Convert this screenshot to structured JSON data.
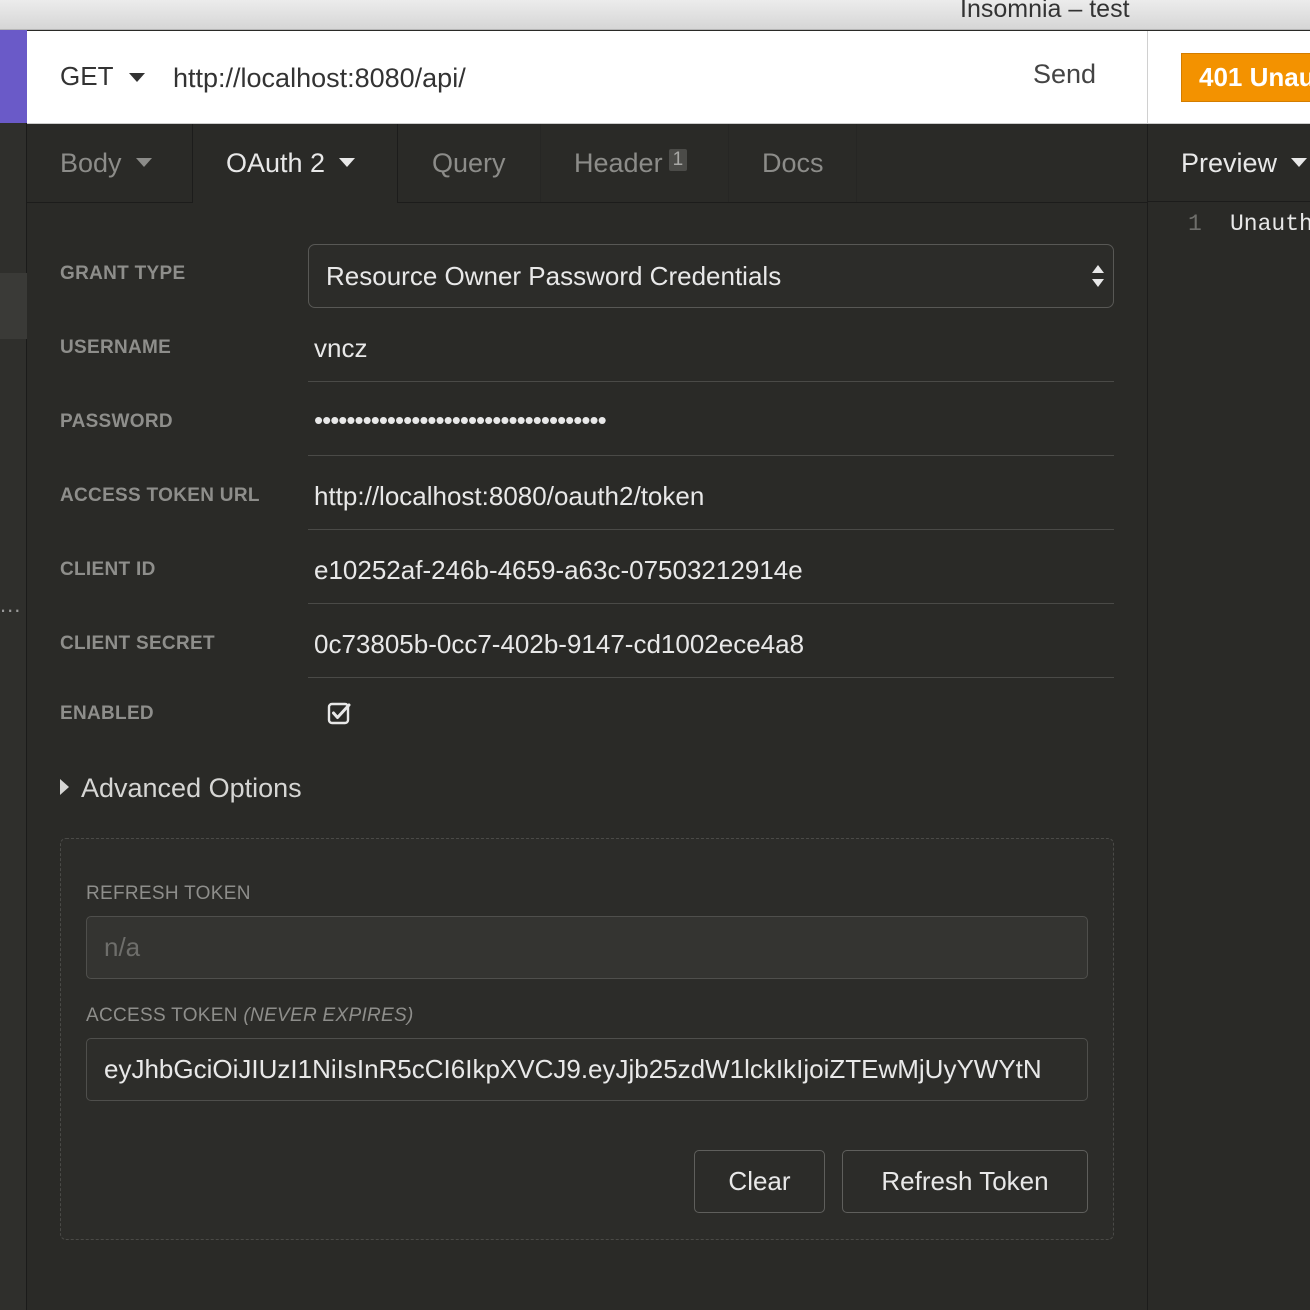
{
  "window": {
    "title": "Insomnia – test"
  },
  "request": {
    "method": "GET",
    "url": "http://localhost:8080/api/",
    "send_label": "Send"
  },
  "response": {
    "status": "401 Unau",
    "status_color": "#f39200",
    "preview_label": "Preview",
    "line_number": "1",
    "body_text": "Unauth"
  },
  "tabs": {
    "body": "Body",
    "oauth": "OAuth 2",
    "query": "Query",
    "header": "Header",
    "header_count": "1",
    "docs": "Docs"
  },
  "form": {
    "grant_type_label": "GRANT TYPE",
    "grant_type_value": "Resource Owner Password Credentials",
    "username_label": "USERNAME",
    "username_value": "vncz",
    "password_label": "PASSWORD",
    "password_value": "••••••••••••••••••••••••••••••••••••",
    "access_token_url_label": "ACCESS TOKEN URL",
    "access_token_url_value": "http://localhost:8080/oauth2/token",
    "client_id_label": "CLIENT ID",
    "client_id_value": "e10252af-246b-4659-a63c-07503212914e",
    "client_secret_label": "CLIENT SECRET",
    "client_secret_value": "0c73805b-0cc7-402b-9147-cd1002ece4a8",
    "enabled_label": "ENABLED",
    "enabled_checked": true,
    "advanced_options_label": "Advanced Options"
  },
  "token_panel": {
    "refresh_token_label": "REFRESH TOKEN",
    "refresh_token_value": "n/a",
    "access_token_label": "ACCESS TOKEN",
    "access_token_note": "(NEVER EXPIRES)",
    "access_token_value": "eyJhbGciOiJIUzI1NiIsInR5cCI6IkpXVCJ9.eyJjb25zdW1lckIkIjoiZTEwMjUyYWYtN",
    "clear_label": "Clear",
    "refresh_label": "Refresh Token"
  },
  "sidebar": {
    "more_dots": "..."
  }
}
